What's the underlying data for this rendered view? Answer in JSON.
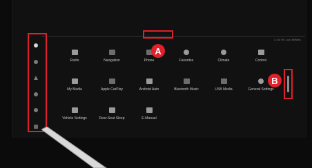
{
  "status_text": "1:16 90 Loc 80Mbs",
  "sidebar": {
    "items": [
      {
        "icon": "home-icon",
        "active": true
      },
      {
        "icon": "music-icon",
        "active": false
      },
      {
        "icon": "navigation-icon",
        "active": false
      },
      {
        "icon": "phone-icon",
        "active": false
      },
      {
        "icon": "apps-icon",
        "active": false
      },
      {
        "icon": "settings-icon",
        "active": false
      }
    ]
  },
  "apps": [
    {
      "label": "Radio",
      "icon": "radio-icon"
    },
    {
      "label": "Navigation",
      "icon": "navigation-icon"
    },
    {
      "label": "Phone",
      "icon": "phone-icon"
    },
    {
      "label": "Favorites",
      "icon": "star-icon"
    },
    {
      "label": "Climate",
      "icon": "fan-icon"
    },
    {
      "label": "Control",
      "icon": "control-icon"
    },
    {
      "label": "My Media",
      "icon": "media-icon"
    },
    {
      "label": "Apple CarPlay",
      "icon": "carplay-icon"
    },
    {
      "label": "Android Auto",
      "icon": "android-auto-icon"
    },
    {
      "label": "Bluetooth Music",
      "icon": "bluetooth-icon"
    },
    {
      "label": "USB Media",
      "icon": "usb-icon"
    },
    {
      "label": "General Settings",
      "icon": "gear-icon"
    },
    {
      "label": "Vehicle Settings",
      "icon": "car-icon"
    },
    {
      "label": "Rear-Seat Sleep",
      "icon": "seat-icon"
    },
    {
      "label": "E-Manual",
      "icon": "book-icon"
    }
  ],
  "annotations": {
    "marker_a": "A",
    "marker_b": "B",
    "highlight_color": "#e0202a"
  }
}
